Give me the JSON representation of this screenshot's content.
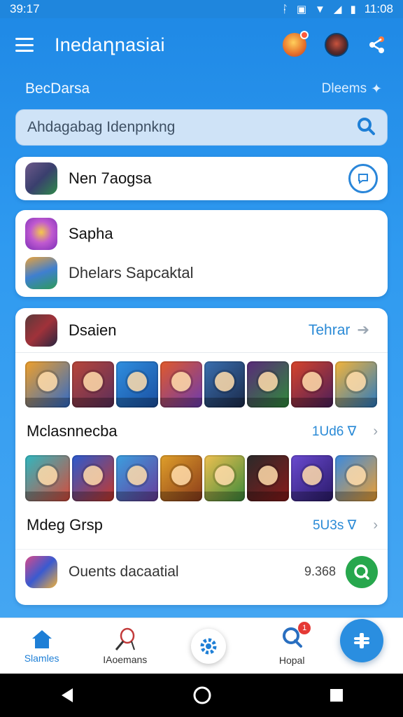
{
  "status_bar": {
    "time": "39:17",
    "clock": "11:08"
  },
  "app_bar": {
    "title": "Inedaղnasiai"
  },
  "section": {
    "title": "BecDarsa",
    "link": "Dleems"
  },
  "search": {
    "placeholder": "Ahdagabag Idenpnkng"
  },
  "card1": {
    "label": "Nen 7aogsa"
  },
  "card2": {
    "item1": "Sapha",
    "item2": "Dhelars Sapcaktal"
  },
  "card3": {
    "header_label": "Dsaien",
    "header_link": "Tehrar",
    "row1_title": "Mclasnnecba",
    "row1_meta": "1Ud6 ∇",
    "row2_title": "Mdeg Grsp",
    "row2_meta": "5U3s ∇",
    "bottom_label": "Ouents dacaatial",
    "bottom_count": "9.368"
  },
  "nav": {
    "item1": "Slamles",
    "item2": "IAoemans",
    "item4": "Hopal",
    "badge": "1"
  },
  "colors": {
    "primary": "#1e88e5",
    "accent_green": "#27a74d",
    "link_blue": "#2a8ad6"
  },
  "icons": [
    "menu-icon",
    "share-icon",
    "search-icon",
    "chat-icon",
    "home-icon",
    "badminton-icon",
    "gear-icon",
    "trophy-icon",
    "plus-icon"
  ]
}
